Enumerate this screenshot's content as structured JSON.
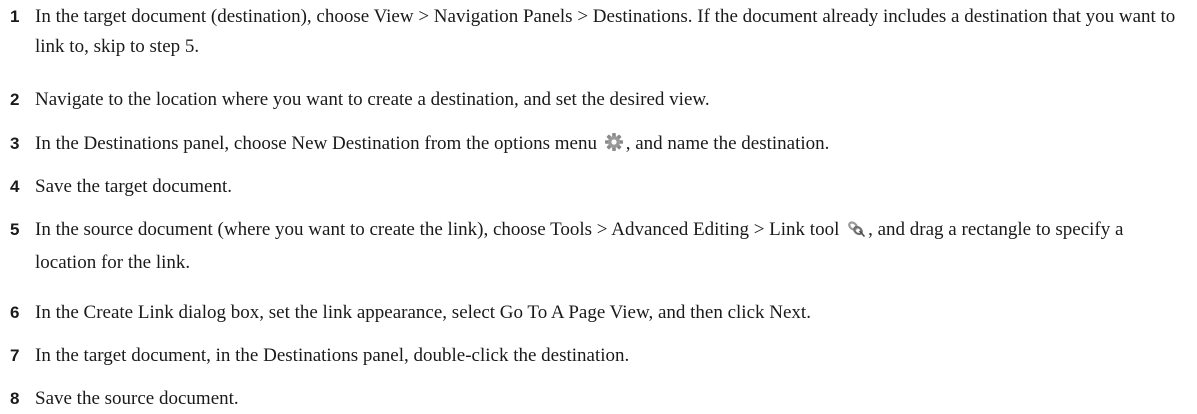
{
  "steps": [
    {
      "number": "1",
      "text": "In the target document (destination), choose View > Navigation Panels > Destinations. If the document already includes a destination that you want to link to, skip to step 5."
    },
    {
      "number": "2",
      "text": "Navigate to the location where you want to create a destination, and set the desired view."
    },
    {
      "number": "3",
      "text_before": "In the Destinations panel, choose New Destination from the options menu",
      "icon": "gear-icon",
      "text_after": ", and name the destination."
    },
    {
      "number": "4",
      "text": "Save the target document."
    },
    {
      "number": "5",
      "text_before": "In the source document (where you want to create the link), choose Tools > Advanced Editing > Link tool",
      "icon": "link-tool-icon",
      "text_after": ", and drag a rectangle to specify a location for the link."
    },
    {
      "number": "6",
      "text": "In the Create Link dialog box, set the link appearance, select Go To A Page View, and then click Next."
    },
    {
      "number": "7",
      "text": "In the target document, in the Destinations panel, double-click the destination."
    },
    {
      "number": "8",
      "text": "Save the source document."
    }
  ]
}
